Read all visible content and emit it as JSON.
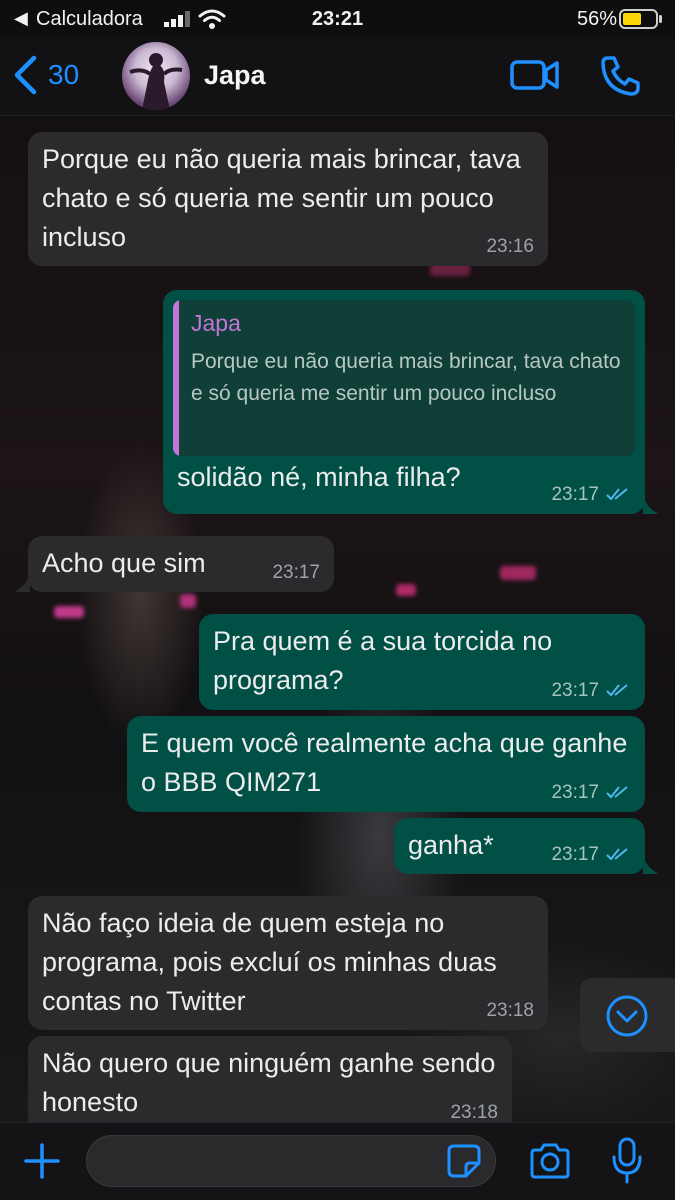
{
  "status_bar": {
    "back_app": "Calculadora",
    "time": "23:21",
    "battery": "56%"
  },
  "header": {
    "back_count": "30",
    "contact_name": "Japa",
    "icons": {
      "back": "chevron-left-icon",
      "video": "video-camera-icon",
      "phone": "phone-icon"
    }
  },
  "messages": [
    {
      "direction": "incoming",
      "text": "Porque eu não queria mais brincar, tava chato e só queria me sentir um pouco incluso",
      "time": "23:16"
    },
    {
      "direction": "outgoing",
      "reply_to": {
        "author": "Japa",
        "text": "Porque eu não queria mais brincar, tava chato e só queria me sentir um pouco incluso"
      },
      "text": "solidão né, minha filha?",
      "time": "23:17",
      "status": "read"
    },
    {
      "direction": "incoming",
      "text": "Acho que sim",
      "time": "23:17"
    },
    {
      "direction": "outgoing",
      "text": "Pra quem é a sua torcida no programa?",
      "time": "23:17",
      "status": "read"
    },
    {
      "direction": "outgoing",
      "text": "E quem você realmente acha que ganhe o BBB QIM271",
      "time": "23:17",
      "status": "read"
    },
    {
      "direction": "outgoing",
      "text": "ganha*",
      "time": "23:17",
      "status": "read"
    },
    {
      "direction": "incoming",
      "text": "Não faço ideia de quem esteja no programa, pois excluí os minhas duas contas no Twitter",
      "time": "23:18"
    },
    {
      "direction": "incoming",
      "text": "Não quero que ninguém ganhe sendo honesto",
      "time": "23:18"
    }
  ],
  "input_bar": {
    "placeholder": "",
    "icons": [
      "plus-icon",
      "sticker-icon",
      "camera-icon",
      "microphone-icon"
    ]
  },
  "colors": {
    "accent": "#1e90ff",
    "incoming_bubble": "#2b2b2e",
    "outgoing_bubble": "#005046",
    "quote_author": "#c275d8",
    "read_ticks": "#4fb6ec"
  }
}
